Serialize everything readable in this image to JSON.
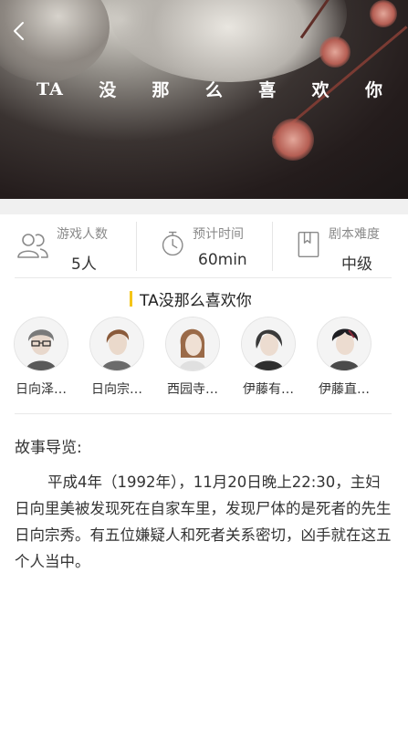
{
  "header": {
    "title_chars": [
      "TA",
      "没",
      "那",
      "么",
      "喜",
      "欢",
      "你"
    ],
    "back_icon": "chevron-left-icon"
  },
  "stats": [
    {
      "label": "游戏人数",
      "value": "5人",
      "icon": "users-icon"
    },
    {
      "label": "预计时间",
      "value": "60min",
      "icon": "stopwatch-icon"
    },
    {
      "label": "剧本难度",
      "value": "中级",
      "icon": "bookmark-book-icon"
    }
  ],
  "script": {
    "title": "TA没那么喜欢你",
    "accent_color": "#f5c518"
  },
  "roles": [
    {
      "name": "日向泽…"
    },
    {
      "name": "日向宗…"
    },
    {
      "name": "西园寺…"
    },
    {
      "name": "伊藤有…"
    },
    {
      "name": "伊藤直…"
    }
  ],
  "story": {
    "heading": "故事导览:",
    "body": "平成4年（1992年），11月20日晚上22:30，主妇日向里美被发现死在自家车里，发现尸体的是死者的先生日向宗秀。有五位嫌疑人和死者关系密切，凶手就在这五个人当中。"
  }
}
